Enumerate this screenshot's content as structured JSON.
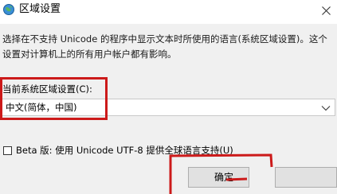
{
  "window": {
    "title": "区域设置",
    "title_icon": "globe-icon",
    "close_icon": "close-icon"
  },
  "description": "选择在不支持 Unicode 的程序中显示文本时所使用的语言(系统区域设置)。这个设置对计算机上的所有用户帐户都有影响。",
  "locale": {
    "label": "当前系统区域设置(C):",
    "selected": "中文(简体，中国)",
    "dropdown_icon": "chevron-down-icon"
  },
  "beta": {
    "checked": false,
    "label": "Beta 版: 使用 Unicode UTF-8 提供全球语言支持(U)"
  },
  "buttons": {
    "ok_label": "确定"
  },
  "annotation_color": "#cc1a1a"
}
